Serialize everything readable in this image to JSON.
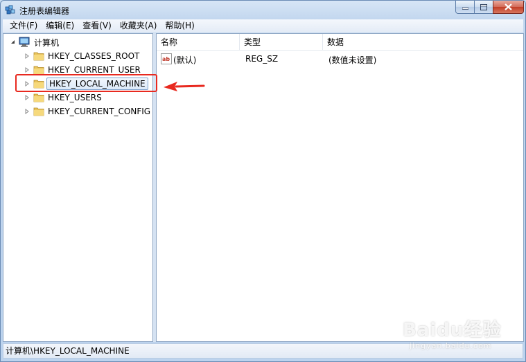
{
  "window": {
    "title": "注册表编辑器"
  },
  "menu": [
    "文件(F)",
    "编辑(E)",
    "查看(V)",
    "收藏夹(A)",
    "帮助(H)"
  ],
  "tree": {
    "root": "计算机",
    "keys": [
      "HKEY_CLASSES_ROOT",
      "HKEY_CURRENT_USER",
      "HKEY_LOCAL_MACHINE",
      "HKEY_USERS",
      "HKEY_CURRENT_CONFIG"
    ],
    "selected": "HKEY_LOCAL_MACHINE"
  },
  "list": {
    "columns": [
      "名称",
      "类型",
      "数据"
    ],
    "rows": [
      {
        "name": "(默认)",
        "type": "REG_SZ",
        "data": "(数值未设置)",
        "icon": "string-value-icon"
      }
    ]
  },
  "status": {
    "path": "计算机\\HKEY_LOCAL_MACHINE"
  },
  "annotation": {
    "box_color": "#e8291f",
    "arrow_color": "#e8291f"
  },
  "watermark": {
    "brand": "Baidu经验",
    "url": "jingyan.baidu.com"
  }
}
